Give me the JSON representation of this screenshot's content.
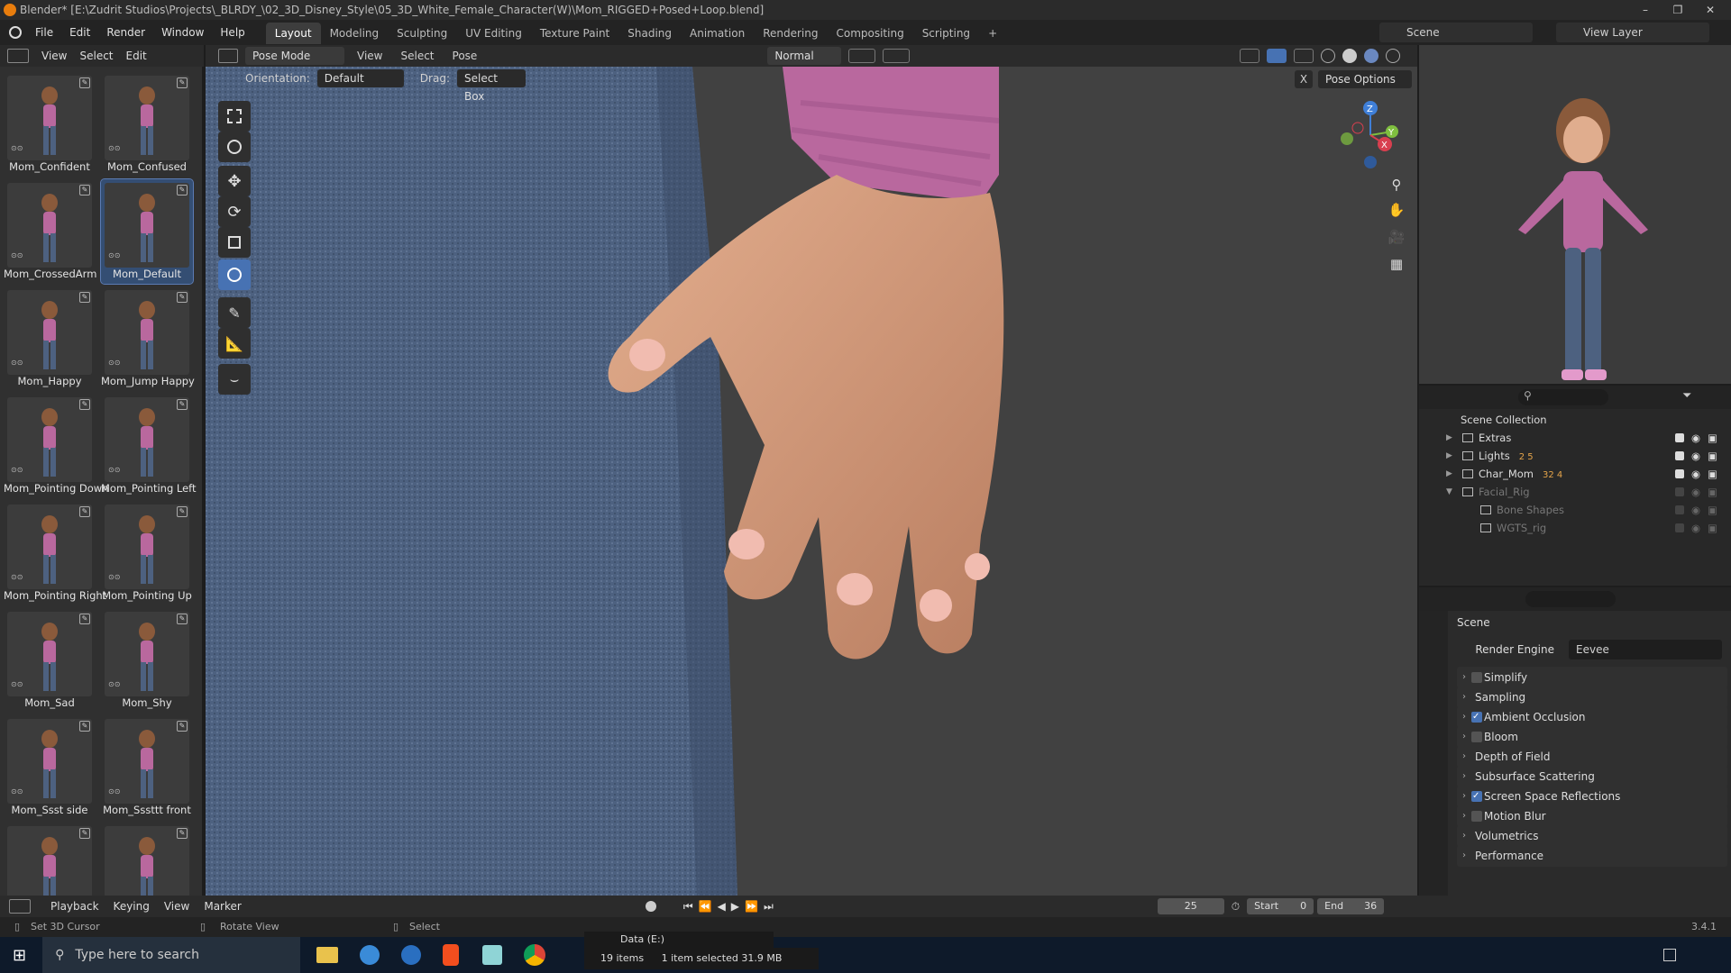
{
  "window": {
    "title": "Blender* [E:\\Zudrit Studios\\Projects\\_BLRDY_\\02_3D_Disney_Style\\05_3D_White_Female_Character(W)\\Mom_RIGGED+Posed+Loop.blend]",
    "minimize": "–",
    "maximize": "❐",
    "close": "✕"
  },
  "menubar": {
    "menus": [
      "File",
      "Edit",
      "Render",
      "Window",
      "Help"
    ],
    "workspaces": [
      "Layout",
      "Modeling",
      "Sculpting",
      "UV Editing",
      "Texture Paint",
      "Shading",
      "Animation",
      "Rendering",
      "Compositing",
      "Scripting"
    ],
    "add_workspace": "+",
    "scene_label": "Scene",
    "view_layer_label": "View Layer"
  },
  "asset_library": {
    "header_items": [
      "View",
      "Select",
      "Edit"
    ],
    "tiles": [
      {
        "label": "Mom_Confident"
      },
      {
        "label": "Mom_Confused"
      },
      {
        "label": "Mom_CrossedArm"
      },
      {
        "label": "Mom_Default"
      },
      {
        "label": "Mom_Happy"
      },
      {
        "label": "Mom_Jump Happy"
      },
      {
        "label": "Mom_Pointing Down"
      },
      {
        "label": "Mom_Pointing Left"
      },
      {
        "label": "Mom_Pointing Right"
      },
      {
        "label": "Mom_Pointing Up"
      },
      {
        "label": "Mom_Sad"
      },
      {
        "label": "Mom_Shy"
      },
      {
        "label": "Mom_Ssst side"
      },
      {
        "label": "Mom_Sssttt front"
      },
      {
        "label": ""
      },
      {
        "label": ""
      }
    ],
    "selected_index": 3
  },
  "viewport": {
    "mode": "Pose Mode",
    "header_menus": [
      "View",
      "Select",
      "Pose"
    ],
    "transform_orientation": "Normal",
    "orientation_label": "Orientation:",
    "orientation_value": "Default",
    "drag_label": "Drag:",
    "drag_value": "Select Box",
    "pose_options": "Pose Options",
    "x_label": "X",
    "gizmo": {
      "x": "X",
      "y": "Y",
      "z": "Z"
    }
  },
  "outliner": {
    "root": "Scene Collection",
    "rows": [
      {
        "label": "Extras",
        "dim": false,
        "counts": ""
      },
      {
        "label": "Lights",
        "dim": false,
        "counts": "2  5"
      },
      {
        "label": "Char_Mom",
        "dim": false,
        "counts": "32   4"
      },
      {
        "label": "Facial_Rig",
        "dim": true,
        "counts": ""
      },
      {
        "label": "Bone Shapes",
        "dim": true,
        "counts": ""
      },
      {
        "label": "WGTS_rig",
        "dim": true,
        "counts": ""
      }
    ]
  },
  "properties": {
    "scene_label": "Scene",
    "render_engine_label": "Render Engine",
    "render_engine_value": "Eevee",
    "sections": [
      {
        "label": "Simplify",
        "checkbox": true,
        "checked": false
      },
      {
        "label": "Sampling",
        "checkbox": false,
        "checked": false
      },
      {
        "label": "Ambient Occlusion",
        "checkbox": true,
        "checked": true
      },
      {
        "label": "Bloom",
        "checkbox": true,
        "checked": false
      },
      {
        "label": "Depth of Field",
        "checkbox": false,
        "checked": false
      },
      {
        "label": "Subsurface Scattering",
        "checkbox": false,
        "checked": false
      },
      {
        "label": "Screen Space Reflections",
        "checkbox": true,
        "checked": true
      },
      {
        "label": "Motion Blur",
        "checkbox": true,
        "checked": false
      },
      {
        "label": "Volumetrics",
        "checkbox": false,
        "checked": false
      },
      {
        "label": "Performance",
        "checkbox": false,
        "checked": false
      }
    ]
  },
  "timeline": {
    "menus": [
      "Playback",
      "Keying",
      "View",
      "Marker"
    ],
    "current_frame": "25",
    "start_label": "Start",
    "start_value": "0",
    "end_label": "End",
    "end_value": "36",
    "version": "3.4.1"
  },
  "statusbar": {
    "hint1": "Set 3D Cursor",
    "hint2": "Rotate View",
    "hint3": "Select",
    "drive": "Data (E:)",
    "items": "19 items",
    "selected": "1 item selected  31.9 MB"
  },
  "taskbar": {
    "search_placeholder": "Type here to search"
  },
  "colors": {
    "accent": "#4772b3",
    "skin": "#d89e7c",
    "jeans": "#4d6180",
    "sweater": "#b9689e"
  }
}
